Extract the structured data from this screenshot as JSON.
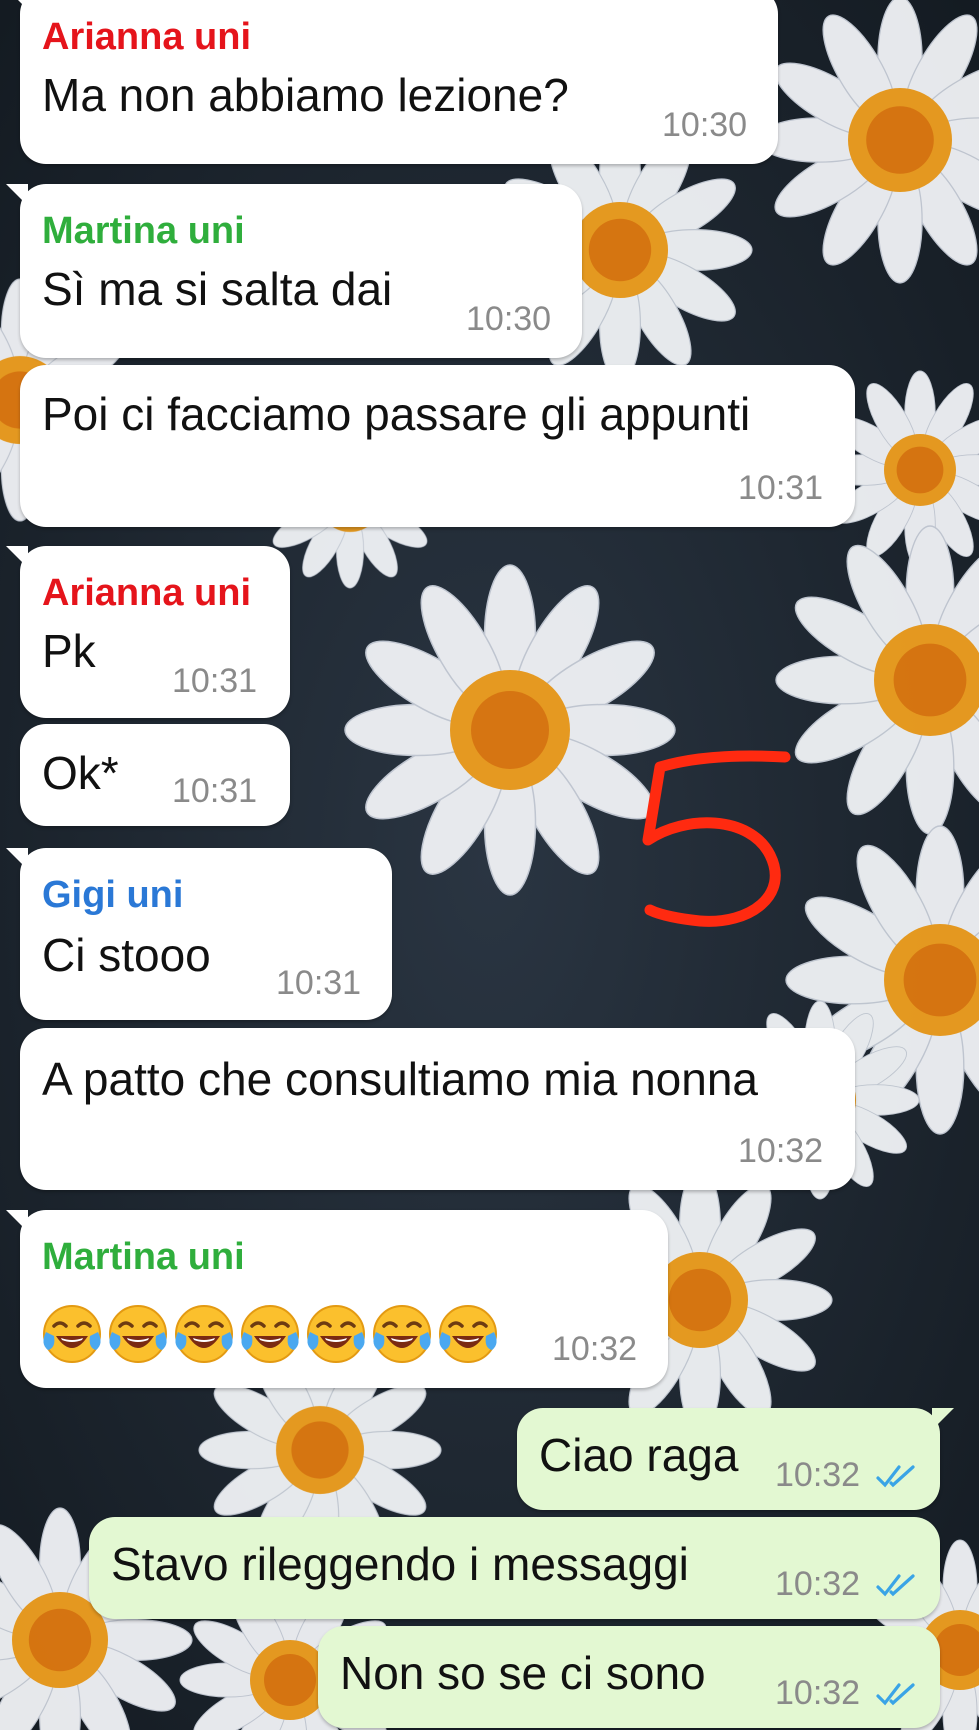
{
  "colors": {
    "sender_arianna": "#e5141b",
    "sender_martina": "#2fae3c",
    "sender_gigi": "#2a78d6",
    "bubble_in": "#ffffff",
    "bubble_out": "#e3f8d2",
    "time": "#8a8a8a",
    "read_ticks": "#3aa4e6",
    "annotation": "#ff2a10"
  },
  "messages": [
    {
      "sender": "Arianna uni",
      "text": "Ma non abbiamo lezione?",
      "time": "10:30"
    },
    {
      "sender": "Martina uni",
      "text": "Sì ma si salta dai",
      "time": "10:30"
    },
    {
      "text": "Poi ci facciamo passare gli appunti",
      "time": "10:31"
    },
    {
      "sender": "Arianna uni",
      "text": "Pk",
      "time": "10:31"
    },
    {
      "text": "Ok*",
      "time": "10:31"
    },
    {
      "sender": "Gigi uni",
      "text": "Ci stooo",
      "time": "10:31"
    },
    {
      "text": "A patto che consultiamo mia nonna",
      "time": "10:32"
    },
    {
      "sender": "Martina uni",
      "emoji": "face-with-tears-of-joy",
      "emoji_count": 7,
      "time": "10:32"
    }
  ],
  "outgoing": [
    {
      "text": "Ciao raga",
      "time": "10:32",
      "status_icon": "double-check-read-icon"
    },
    {
      "text": "Stavo rileggendo i messaggi",
      "time": "10:32",
      "status_icon": "double-check-read-icon"
    },
    {
      "text": "Non so se ci sono",
      "time": "10:32",
      "status_icon": "double-check-read-icon"
    }
  ],
  "annotation": {
    "icon": "handwritten-number-5"
  }
}
